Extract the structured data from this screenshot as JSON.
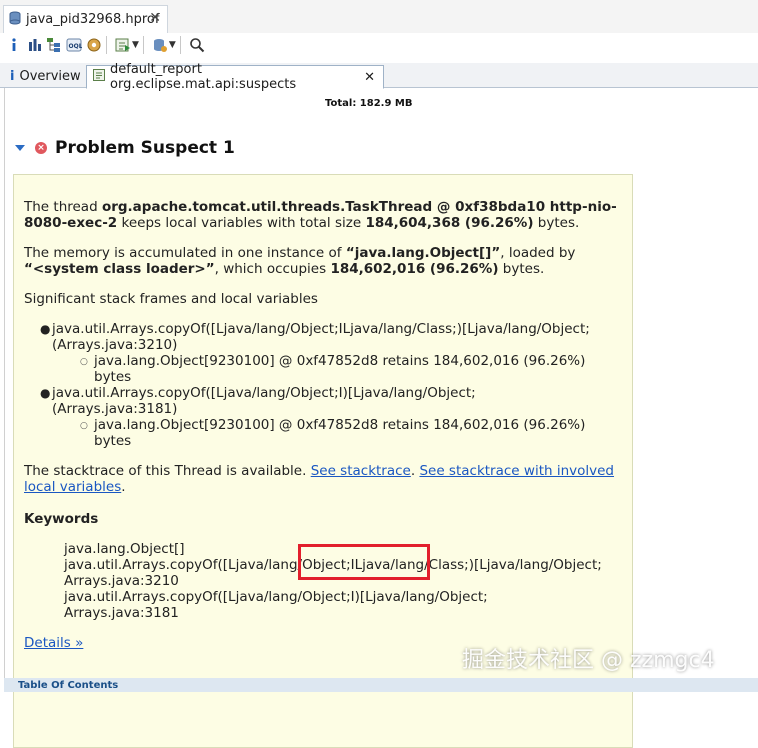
{
  "editor_tab": {
    "title": "java_pid32968.hprof"
  },
  "toolbar": {
    "icons": [
      "info-icon",
      "histogram-icon",
      "dominator-tree-icon",
      "oql-icon",
      "thread-overview-icon",
      "run-report-icon",
      "heap-dump-details-icon",
      "search-icon"
    ]
  },
  "inner_tabs": [
    {
      "label": "Overview"
    },
    {
      "label": "default_report org.eclipse.mat.api:suspects"
    }
  ],
  "total": "Total: 182.9 MB",
  "suspect": {
    "title": "Problem Suspect 1",
    "p1": {
      "pre": "The thread ",
      "thread": "org.apache.tomcat.util.threads.TaskThread @ 0xf38bda10 http-nio-8080-exec-2",
      "mid": " keeps local variables with total size ",
      "size": "184,604,368 (96.26%)",
      "post": " bytes."
    },
    "p2": {
      "pre": "The memory is accumulated in one instance of ",
      "cls": "“java.lang.Object[]”",
      "mid": ", loaded by ",
      "loader": "“<system class loader>”",
      "mid2": ", which occupies ",
      "size": "184,602,016 (96.26%)",
      "post": " bytes."
    },
    "frames_heading": "Significant stack frames and local variables",
    "frames": [
      {
        "line1": "java.util.Arrays.copyOf([Ljava/lang/Object;ILjava/lang/Class;)[Ljava/lang/Object;",
        "line2": "(Arrays.java:3210)",
        "sub1": "java.lang.Object[9230100] @ 0xf47852d8 retains 184,602,016 (96.26%)",
        "sub2": "bytes"
      },
      {
        "line1": "java.util.Arrays.copyOf([Ljava/lang/Object;I)[Ljava/lang/Object;",
        "line2": "(Arrays.java:3181)",
        "sub1": "java.lang.Object[9230100] @ 0xf47852d8 retains 184,602,016 (96.26%)",
        "sub2": "bytes"
      }
    ],
    "stack_text": "The stacktrace of this Thread is available. ",
    "stack_link1": "See stacktrace",
    "stack_sep": ". ",
    "stack_link2a": "See stacktrace with involved",
    "stack_link2b": "local variables",
    "stack_end": ".",
    "keywords_heading": "Keywords",
    "keywords": [
      "java.lang.Object[]",
      "java.util.Arrays.copyOf([Ljava/lang/Object;ILjava/lang/Class;)[Ljava/lang/Object;",
      "Arrays.java:3210",
      "java.util.Arrays.copyOf([Ljava/lang/Object;I)[Ljava/lang/Object;",
      "Arrays.java:3181"
    ],
    "details_link": "Details »"
  },
  "toc": "Table Of Contents",
  "watermark": "掘金技术社区 @ zzmgc4",
  "colors": {
    "panel_bg": "#fdfde4",
    "link": "#1a57c2",
    "highlight": "#e21f2c"
  }
}
